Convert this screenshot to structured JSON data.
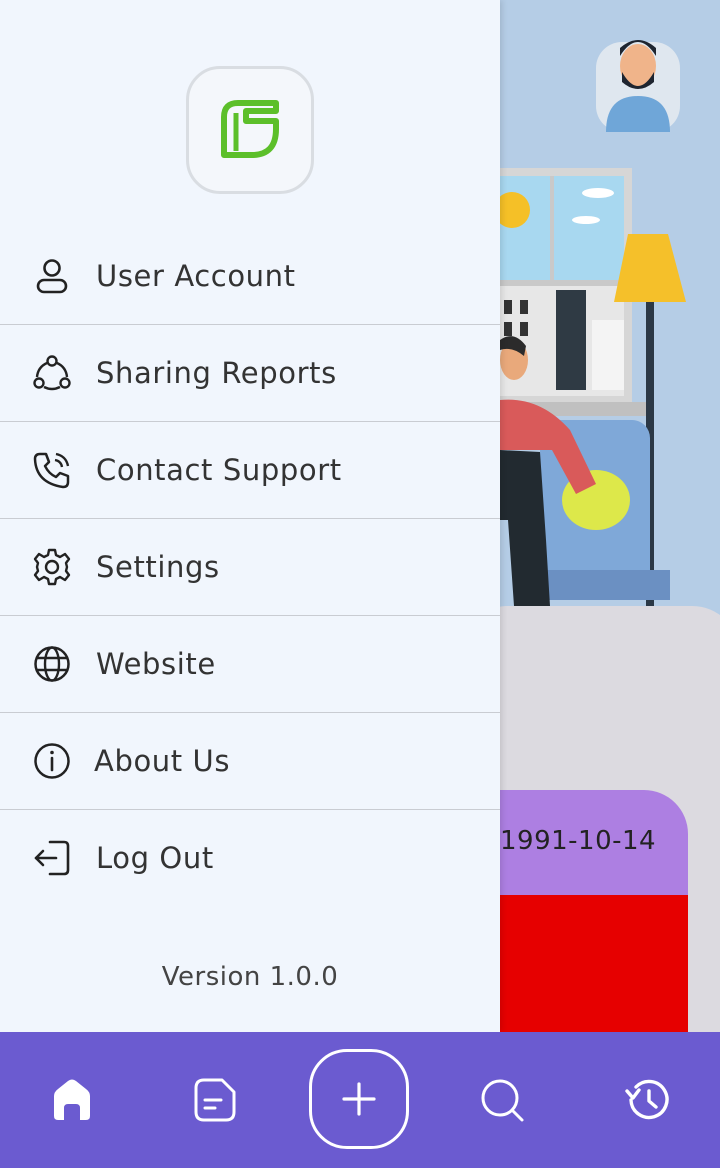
{
  "drawer": {
    "logo_icon": "leaf-logo-icon",
    "menu": [
      {
        "label": "User Account",
        "icon": "user-icon"
      },
      {
        "label": "Sharing Reports",
        "icon": "share-nodes-icon"
      },
      {
        "label": "Contact Support",
        "icon": "phone-icon"
      },
      {
        "label": "Settings",
        "icon": "gear-icon"
      },
      {
        "label": "Website",
        "icon": "globe-icon"
      },
      {
        "label": "About Us",
        "icon": "info-icon"
      },
      {
        "label": "Log Out",
        "icon": "logout-icon"
      }
    ],
    "version": "Version 1.0.0"
  },
  "background": {
    "date": "1991-10-14"
  },
  "bottom_nav": {
    "items": [
      "home-icon",
      "document-icon",
      "add-icon",
      "search-icon",
      "history-icon"
    ]
  },
  "colors": {
    "nav": "#6b5bd0",
    "accent_green": "#5cbf2a",
    "date_card": "#ad7fe2",
    "red_block": "#e60000",
    "drawer_bg": "#f1f6fd"
  }
}
